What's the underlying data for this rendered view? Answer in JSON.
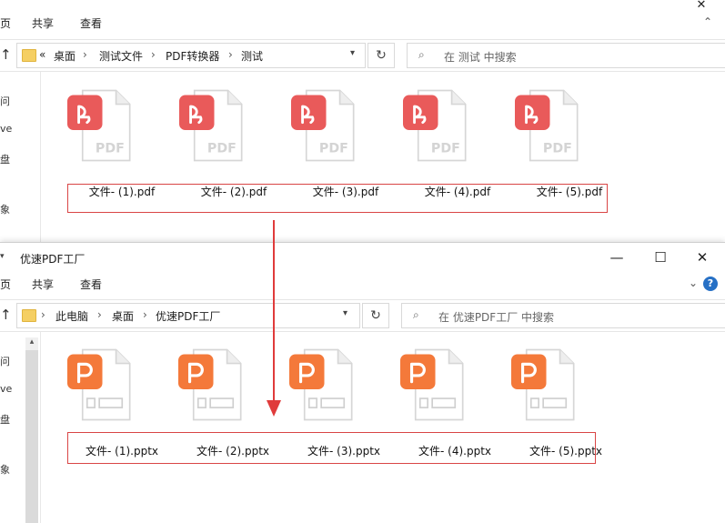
{
  "win1": {
    "title_fragment": "",
    "ribbon": {
      "tab_cut": "页",
      "share": "共享",
      "view": "查看"
    },
    "addr": {
      "overflow": "«",
      "crumbs": [
        "桌面",
        "测试文件",
        "PDF转换器",
        "测试"
      ]
    },
    "search_placeholder": "在 测试 中搜索",
    "nav": [
      "问",
      "ve",
      "盘",
      "象"
    ],
    "files": [
      "文件- (1).pdf",
      "文件- (2).pdf",
      "文件- (3).pdf",
      "文件- (4).pdf",
      "文件- (5).pdf"
    ],
    "badge_color": "#e95a5a",
    "doc_label": "PDF"
  },
  "win2": {
    "title": "优速PDF工厂",
    "ribbon": {
      "tab_cut": "页",
      "share": "共享",
      "view": "查看"
    },
    "controls": {
      "minimize": "—",
      "maximize": "☐",
      "close": "✕"
    },
    "addr": {
      "crumbs": [
        "此电脑",
        "桌面",
        "优速PDF工厂"
      ]
    },
    "search_placeholder": "在 优速PDF工厂 中搜索",
    "nav": [
      "问",
      "ve",
      "盘",
      "象"
    ],
    "files": [
      "文件- (1).pptx",
      "文件- (2).pptx",
      "文件- (3).pptx",
      "文件- (4).pptx",
      "文件- (5).pptx"
    ],
    "badge_color": "#f4793a"
  },
  "annotation": {
    "box_color": "#d94545",
    "arrow_color": "#e03b3b"
  }
}
